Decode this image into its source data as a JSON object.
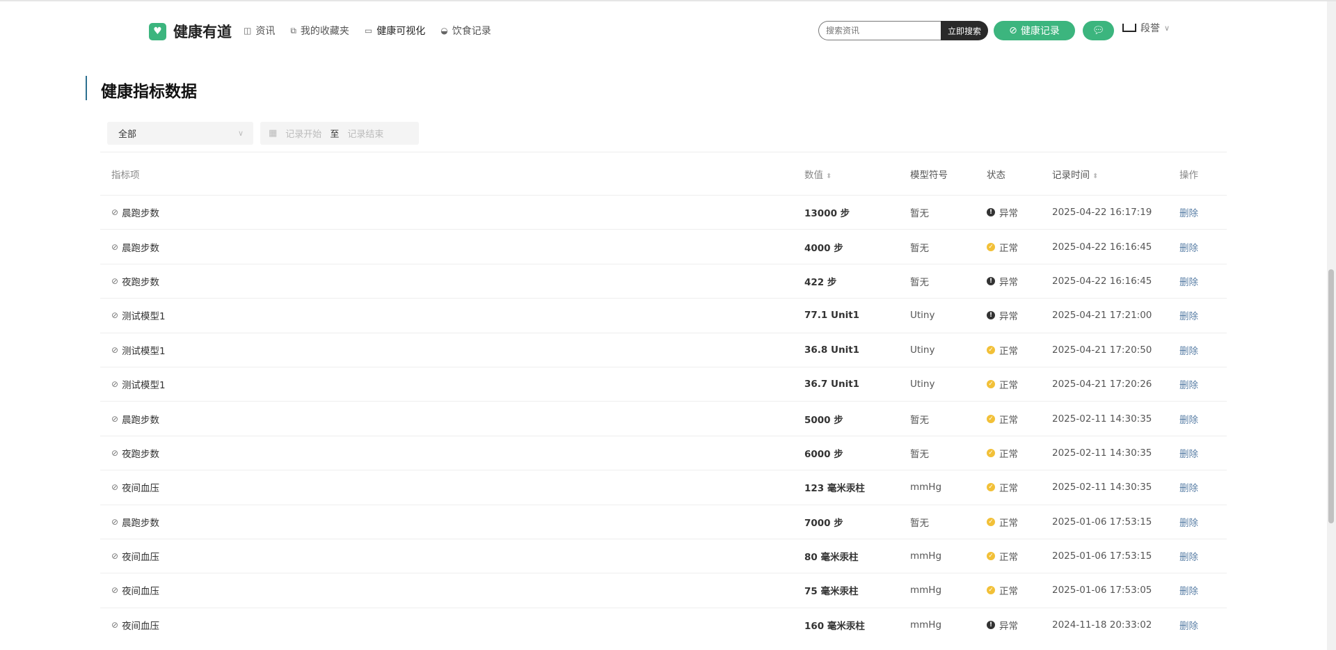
{
  "header": {
    "logo": "健康有道",
    "nav": [
      {
        "icon": "book-icon",
        "label": "资讯"
      },
      {
        "icon": "copy-icon",
        "label": "我的收藏夹"
      },
      {
        "icon": "monitor-icon",
        "label": "健康可视化"
      },
      {
        "icon": "bowl-icon",
        "label": "饮食记录"
      }
    ],
    "search_placeholder": "搜索资讯",
    "search_button": "立即搜索",
    "record_button": "健康记录",
    "user_name": "段誉"
  },
  "page": {
    "title": "健康指标数据"
  },
  "filters": {
    "select_value": "全部",
    "date_start_placeholder": "记录开始",
    "date_sep": "至",
    "date_end_placeholder": "记录结束"
  },
  "table": {
    "headers": [
      "指标项",
      "数值",
      "模型符号",
      "状态",
      "记录时间",
      "操作"
    ],
    "rows": [
      {
        "name": "晨跑步数",
        "value": "13000 步",
        "symbol": "暂无",
        "status": "异常",
        "time": "2025-04-22 16:17:19",
        "action": "删除"
      },
      {
        "name": "晨跑步数",
        "value": "4000 步",
        "symbol": "暂无",
        "status": "正常",
        "time": "2025-04-22 16:16:45",
        "action": "删除"
      },
      {
        "name": "夜跑步数",
        "value": "422 步",
        "symbol": "暂无",
        "status": "异常",
        "time": "2025-04-22 16:16:45",
        "action": "删除"
      },
      {
        "name": "测试模型1",
        "value": "77.1 Unit1",
        "symbol": "Utiny",
        "status": "异常",
        "time": "2025-04-21 17:21:00",
        "action": "删除"
      },
      {
        "name": "测试模型1",
        "value": "36.8 Unit1",
        "symbol": "Utiny",
        "status": "正常",
        "time": "2025-04-21 17:20:50",
        "action": "删除"
      },
      {
        "name": "测试模型1",
        "value": "36.7 Unit1",
        "symbol": "Utiny",
        "status": "正常",
        "time": "2025-04-21 17:20:26",
        "action": "删除"
      },
      {
        "name": "晨跑步数",
        "value": "5000 步",
        "symbol": "暂无",
        "status": "正常",
        "time": "2025-02-11 14:30:35",
        "action": "删除"
      },
      {
        "name": "夜跑步数",
        "value": "6000 步",
        "symbol": "暂无",
        "status": "正常",
        "time": "2025-02-11 14:30:35",
        "action": "删除"
      },
      {
        "name": "夜间血压",
        "value": "123 毫米汞柱",
        "symbol": "mmHg",
        "status": "正常",
        "time": "2025-02-11 14:30:35",
        "action": "删除"
      },
      {
        "name": "晨跑步数",
        "value": "7000 步",
        "symbol": "暂无",
        "status": "正常",
        "time": "2025-01-06 17:53:15",
        "action": "删除"
      },
      {
        "name": "夜间血压",
        "value": "80 毫米汞柱",
        "symbol": "mmHg",
        "status": "正常",
        "time": "2025-01-06 17:53:15",
        "action": "删除"
      },
      {
        "name": "夜间血压",
        "value": "75 毫米汞柱",
        "symbol": "mmHg",
        "status": "正常",
        "time": "2025-01-06 17:53:05",
        "action": "删除"
      },
      {
        "name": "夜间血压",
        "value": "160 毫米汞柱",
        "symbol": "mmHg",
        "status": "异常",
        "time": "2024-11-18 20:33:02",
        "action": "删除"
      }
    ]
  },
  "colors": {
    "brand": "#3cb57e",
    "normal": "#f2c037",
    "abnormal": "#333333",
    "link": "#5a7fa6"
  }
}
